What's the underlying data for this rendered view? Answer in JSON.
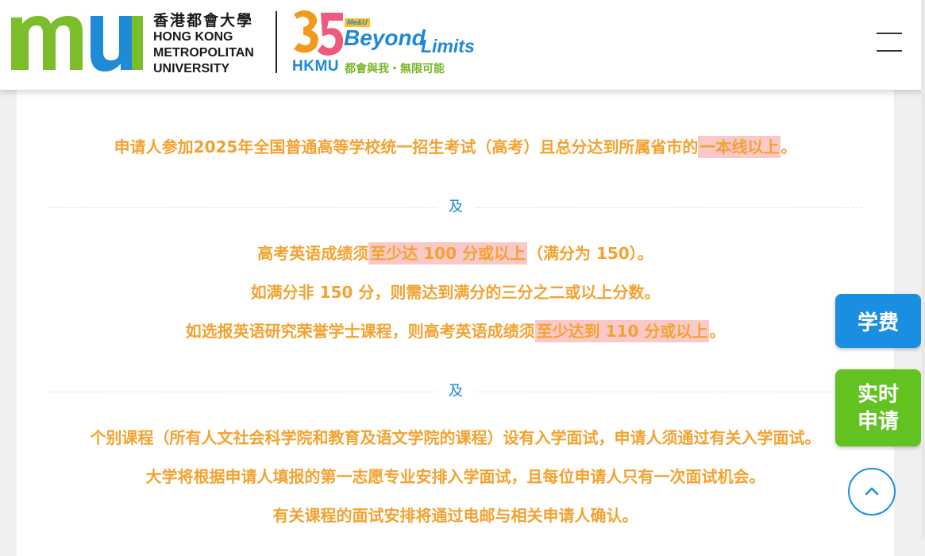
{
  "header": {
    "logo_zh": "香港都會大學",
    "logo_en_lines": [
      "HONG KONG",
      "METROPOLITAN",
      "UNIVERSITY"
    ],
    "anniversary": {
      "number": "35",
      "me_u": "Me&U",
      "beyond": "Beyond",
      "limits": "Limits",
      "hkmu": "HKMU",
      "slogan": "都會與我・無限可能"
    },
    "menu_icon": "hamburger-menu-icon"
  },
  "content": {
    "req1": {
      "pre": "申请人参加2025年全国普通高等学校统一招生考试（高考）且总分达到所属省市的",
      "hl": "一本线以上",
      "post": "。"
    },
    "sep1": "及",
    "eng1": {
      "pre": "高考英语成绩须",
      "hl": "至少达 100 分或以上",
      "post": "（满分为 150）。"
    },
    "eng2": "如满分非 150 分，则需达到满分的三分之二或以上分数。",
    "eng3": {
      "pre": "如选报英语研究荣誉学士课程，则高考英语成绩须",
      "hl": "至少达到 110 分或以上",
      "post": "。"
    },
    "sep2": "及",
    "interview1": "个别课程（所有人文社会科学院和教育及语文学院的课程）设有入学面试，申请人须通过有关入学面试。",
    "interview2": "大学将根据申请人填报的第一志愿专业安排入学面试，且每位申请人只有一次面试机会。",
    "interview3": "有关课程的面试安排将通过电邮与相关申请人确认。"
  },
  "floating": {
    "fee": "学费",
    "apply_line1": "实时",
    "apply_line2": "申请",
    "back_to_top_icon": "chevron-up-icon"
  },
  "colors": {
    "accent_orange": "#f3a230",
    "highlight_pink": "#f9c9c9",
    "brand_green": "#79b72a",
    "brand_blue": "#1a8ee0"
  }
}
